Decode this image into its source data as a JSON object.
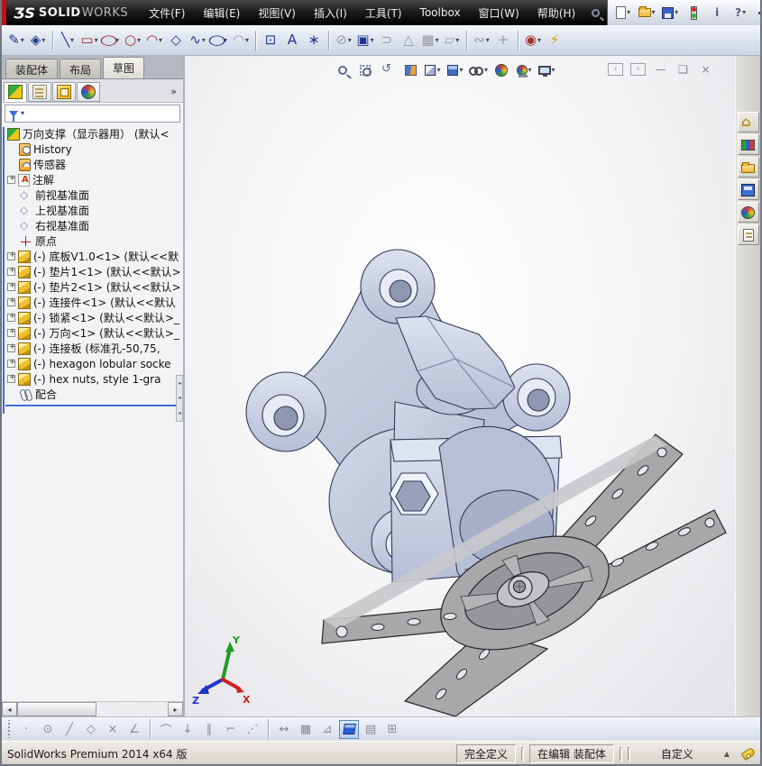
{
  "colors": {
    "accent": "#3a6fd8",
    "model_fill": "#c9d0e2",
    "model_dark": "#aab2ca",
    "plate_fill": "#a8a8ab",
    "outline": "#333a55"
  },
  "titlebar": {
    "logo": {
      "prefix": "ƷS",
      "bold": "SOLID",
      "light": "WORKS"
    },
    "menus": [
      "文件(F)",
      "编辑(E)",
      "视图(V)",
      "插入(I)",
      "工具(T)",
      "Toolbox",
      "窗口(W)",
      "帮助(H)"
    ],
    "std_icons": [
      {
        "name": "new-document",
        "dropdown": true
      },
      {
        "name": "open-file",
        "dropdown": true
      },
      {
        "name": "save",
        "dropdown": true
      },
      {
        "name": "solidworks-resources",
        "dropdown": false
      },
      {
        "name": "info",
        "glyph": "i",
        "dropdown": false
      },
      {
        "name": "help",
        "glyph": "?",
        "dropdown": true
      }
    ]
  },
  "sketch_toolbar": {
    "tools": [
      {
        "name": "sketch-tool",
        "glyph": "✎",
        "color": "#20368f",
        "dropdown": true
      },
      {
        "name": "smart-dimension-tool",
        "glyph": "◈",
        "color": "#20368f",
        "dropdown": true
      },
      {
        "divider": true
      },
      {
        "name": "line-tool",
        "glyph": "╲",
        "color": "#20368f",
        "dropdown": true
      },
      {
        "name": "rectangle-tool",
        "glyph": "▭",
        "color": "#a03028",
        "dropdown": true
      },
      {
        "name": "slot-tool",
        "glyph": "○",
        "color": "#a03028",
        "dropdown": true,
        "wide": true
      },
      {
        "name": "circle-tool",
        "glyph": "○",
        "color": "#a03028",
        "dropdown": true
      },
      {
        "name": "arc-tool",
        "glyph": "◠",
        "color": "#a03028",
        "dropdown": true
      },
      {
        "name": "polygon-tool",
        "glyph": "◇",
        "color": "#20368f",
        "dropdown": false
      },
      {
        "name": "spline-tool",
        "glyph": "∿",
        "color": "#20368f",
        "dropdown": true
      },
      {
        "name": "ellipse-tool",
        "glyph": "○",
        "color": "#20368f",
        "dropdown": true,
        "wide": true
      },
      {
        "name": "fillet-tool",
        "glyph": "◠",
        "color": "#9a9aa2",
        "dropdown": true,
        "disabled": true
      },
      {
        "divider": true
      },
      {
        "name": "selection-box-tool",
        "glyph": "⊡",
        "color": "#20368f",
        "dropdown": false
      },
      {
        "name": "text-tool",
        "glyph": "A",
        "color": "#20368f",
        "dropdown": false
      },
      {
        "name": "point-tool",
        "glyph": "∗",
        "color": "#20368f",
        "dropdown": false
      },
      {
        "divider": true
      },
      {
        "name": "trim-entities-tool",
        "glyph": "⊘",
        "color": "#9a9aa2",
        "dropdown": true,
        "disabled": true
      },
      {
        "name": "convert-entities-tool",
        "glyph": "▣",
        "color": "#20368f",
        "dropdown": true
      },
      {
        "name": "offset-entities-tool",
        "glyph": "⊃",
        "color": "#9a9aa2",
        "dropdown": false,
        "disabled": true
      },
      {
        "name": "mirror-entities-tool",
        "glyph": "△",
        "color": "#9a9aa2",
        "dropdown": false,
        "disabled": true
      },
      {
        "name": "linear-pattern-tool",
        "glyph": "▦",
        "color": "#9a9aa2",
        "dropdown": true,
        "disabled": true
      },
      {
        "name": "move-entities-tool",
        "glyph": "▱",
        "color": "#9a9aa2",
        "dropdown": true,
        "disabled": true
      },
      {
        "divider": true
      },
      {
        "name": "display-relations-tool",
        "glyph": "∾",
        "color": "#9a9aa2",
        "dropdown": true,
        "disabled": true
      },
      {
        "name": "repair-sketch-tool",
        "glyph": "+",
        "color": "#9a9aa2",
        "dropdown": false,
        "disabled": true
      },
      {
        "divider": true
      },
      {
        "name": "quick-snaps-tool",
        "glyph": "◉",
        "color": "#a03028",
        "dropdown": true
      },
      {
        "name": "rapid-sketch-tool",
        "glyph": "⚡",
        "color": "#d99f00",
        "dropdown": false
      }
    ]
  },
  "doc_tabs": {
    "tabs": [
      {
        "label": "装配体",
        "active": false
      },
      {
        "label": "布局",
        "active": false
      },
      {
        "label": "草图",
        "active": true
      }
    ]
  },
  "feature_panel": {
    "tabs": [
      "featuremanager",
      "propertymanager",
      "configurationmanager",
      "displaymanager"
    ],
    "overflow_glyph": "»",
    "tree": {
      "root": {
        "label": "万向支撑（显示器用） (默认<",
        "icon": "asm"
      },
      "items": [
        {
          "label": "History",
          "icon": "history"
        },
        {
          "label": "传感器",
          "icon": "sensors"
        },
        {
          "label": "注解",
          "icon": "ann",
          "expander": true
        },
        {
          "label": "前视基准面",
          "icon": "plane"
        },
        {
          "label": "上视基准面",
          "icon": "plane"
        },
        {
          "label": "右视基准面",
          "icon": "plane"
        },
        {
          "label": "原点",
          "icon": "origin"
        },
        {
          "label": "(-) 底板V1.0<1> (默认<<默",
          "icon": "part",
          "expander": true
        },
        {
          "label": "(-) 垫片1<1> (默认<<默认>",
          "icon": "part",
          "expander": true
        },
        {
          "label": "(-) 垫片2<1> (默认<<默认>",
          "icon": "part",
          "expander": true
        },
        {
          "label": "(-) 连接件<1> (默认<<默认",
          "icon": "part",
          "expander": true
        },
        {
          "label": "(-) 锁紧<1> (默认<<默认>_",
          "icon": "part",
          "expander": true
        },
        {
          "label": "(-) 万向<1> (默认<<默认>_",
          "icon": "part",
          "expander": true
        },
        {
          "label": "(-) 连接板 (标准孔-50,75,",
          "icon": "part",
          "expander": true
        },
        {
          "label": "(-) hexagon lobular socke",
          "icon": "part",
          "expander": true
        },
        {
          "label": "(-) hex nuts, style 1-gra",
          "icon": "part",
          "expander": true
        },
        {
          "label": "配合",
          "icon": "mates"
        }
      ]
    }
  },
  "headsup_toolbar": {
    "icons": [
      {
        "name": "zoom-to-fit"
      },
      {
        "name": "zoom-to-area"
      },
      {
        "name": "previous-view"
      },
      {
        "name": "section-view"
      },
      {
        "name": "view-orientation",
        "dropdown": true
      },
      {
        "name": "display-style",
        "dropdown": true
      },
      {
        "name": "hide-show-items",
        "dropdown": true
      },
      {
        "name": "edit-appearance"
      },
      {
        "name": "apply-scene",
        "dropdown": true
      },
      {
        "name": "view-settings",
        "dropdown": true
      }
    ]
  },
  "doc_window_controls": [
    {
      "name": "pane-toggle-left",
      "glyph": "‹"
    },
    {
      "name": "pane-toggle-right",
      "glyph": "›"
    },
    {
      "name": "doc-minimize",
      "glyph": "—"
    },
    {
      "name": "doc-restore",
      "glyph": "❏"
    },
    {
      "name": "doc-close",
      "glyph": "×"
    }
  ],
  "task_pane": {
    "icons": [
      "home",
      "design-library",
      "file-explorer",
      "view-palette",
      "appearances",
      "custom-properties"
    ]
  },
  "viewport": {
    "triad": {
      "x_label": "X",
      "y_label": "Y",
      "z_label": "Z",
      "x_color": "#cc2222",
      "y_color": "#1f9e1f",
      "z_color": "#2233cc"
    }
  },
  "snap_toolbar": {
    "tools": [
      {
        "name": "snap-point",
        "glyph": "·"
      },
      {
        "name": "snap-center",
        "glyph": "⊙"
      },
      {
        "name": "snap-line",
        "glyph": "╱"
      },
      {
        "name": "snap-quadrant",
        "glyph": "◇"
      },
      {
        "name": "snap-intersection",
        "glyph": "×"
      },
      {
        "name": "snap-angle",
        "glyph": "∠"
      },
      {
        "divider": true
      },
      {
        "name": "snap-tangent",
        "glyph": "⌒"
      },
      {
        "name": "snap-midpoint",
        "glyph": "↓"
      },
      {
        "name": "snap-parallel",
        "glyph": "∥"
      },
      {
        "name": "snap-perpendicular",
        "glyph": "⌐"
      },
      {
        "name": "snap-grid-points",
        "glyph": "⋰"
      },
      {
        "divider": true
      },
      {
        "name": "snap-length",
        "glyph": "↔"
      },
      {
        "name": "grid-settings",
        "glyph": "▦"
      },
      {
        "name": "snap-angle-settings",
        "glyph": "⊿"
      },
      {
        "name": "shaded-with-edges-view",
        "cube": true,
        "active": true
      },
      {
        "name": "single-viewport",
        "glyph": "▤"
      },
      {
        "name": "four-viewport",
        "glyph": "⊞"
      }
    ]
  },
  "status_bar": {
    "product": "SolidWorks Premium 2014 x64 版",
    "defined": "完全定义",
    "editing": "在编辑 装配体",
    "custom": "自定义"
  }
}
